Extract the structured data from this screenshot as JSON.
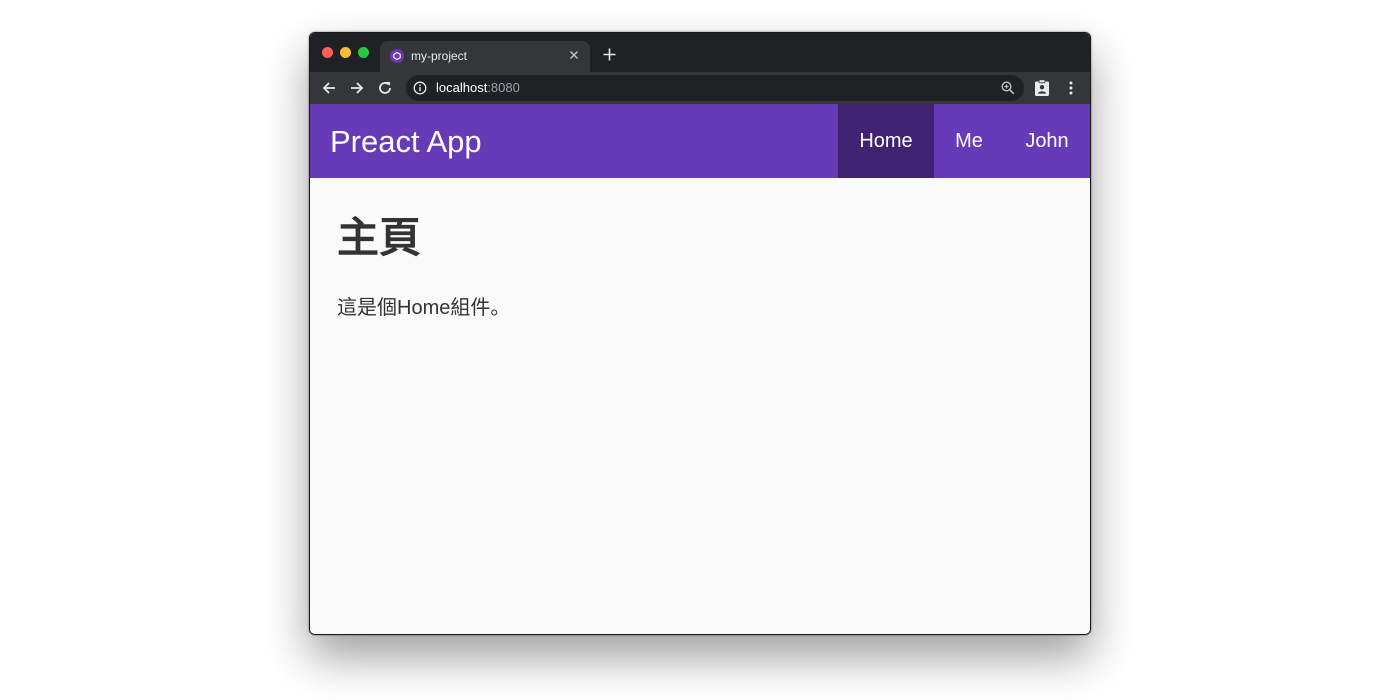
{
  "browser": {
    "tab": {
      "title": "my-project"
    },
    "address_bar": {
      "host": "localhost",
      "port": ":8080"
    }
  },
  "app": {
    "brand": "Preact App",
    "nav": [
      {
        "label": "Home",
        "active": true
      },
      {
        "label": "Me",
        "active": false
      },
      {
        "label": "John",
        "active": false
      }
    ],
    "page": {
      "title": "主頁",
      "body": "這是個Home組件。"
    }
  },
  "colors": {
    "header_bg": "#673ab7",
    "active_nav_bg": "#3f2272",
    "content_bg": "#fafafa",
    "text": "#333333"
  },
  "icons": {
    "tab_favicon": "preact-logo-icon",
    "tab_close": "close-icon",
    "new_tab": "plus-icon",
    "back": "arrow-left-icon",
    "forward": "arrow-right-icon",
    "reload": "reload-icon",
    "site_info": "info-icon",
    "zoom": "zoom-in-icon",
    "extension": "clipboard-account-icon",
    "menu": "vertical-dots-icon"
  }
}
